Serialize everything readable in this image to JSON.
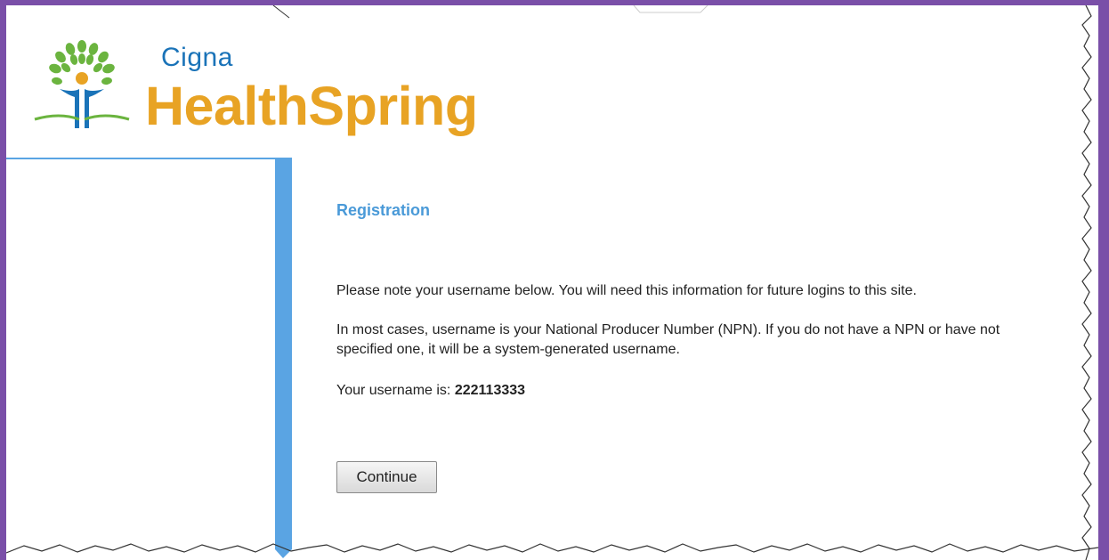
{
  "brand": {
    "company": "Cigna",
    "product": "HealthSpring",
    "colors": {
      "primary_blue": "#1a73b8",
      "accent_orange": "#e8a324",
      "tree_green": "#6bb43f",
      "sidebar_blue": "#5aa4e3",
      "frame_purple": "#7a4fa8"
    }
  },
  "page": {
    "section_title": "Registration",
    "paragraph1": "Please note your username below. You will need this information for future logins to this site.",
    "paragraph2": "In most cases, username is your National Producer Number (NPN). If you do not have a NPN or have not specified one, it will be a system-generated username.",
    "username_label": "Your username is:",
    "username_value": "222113333",
    "continue_label": "Continue"
  }
}
